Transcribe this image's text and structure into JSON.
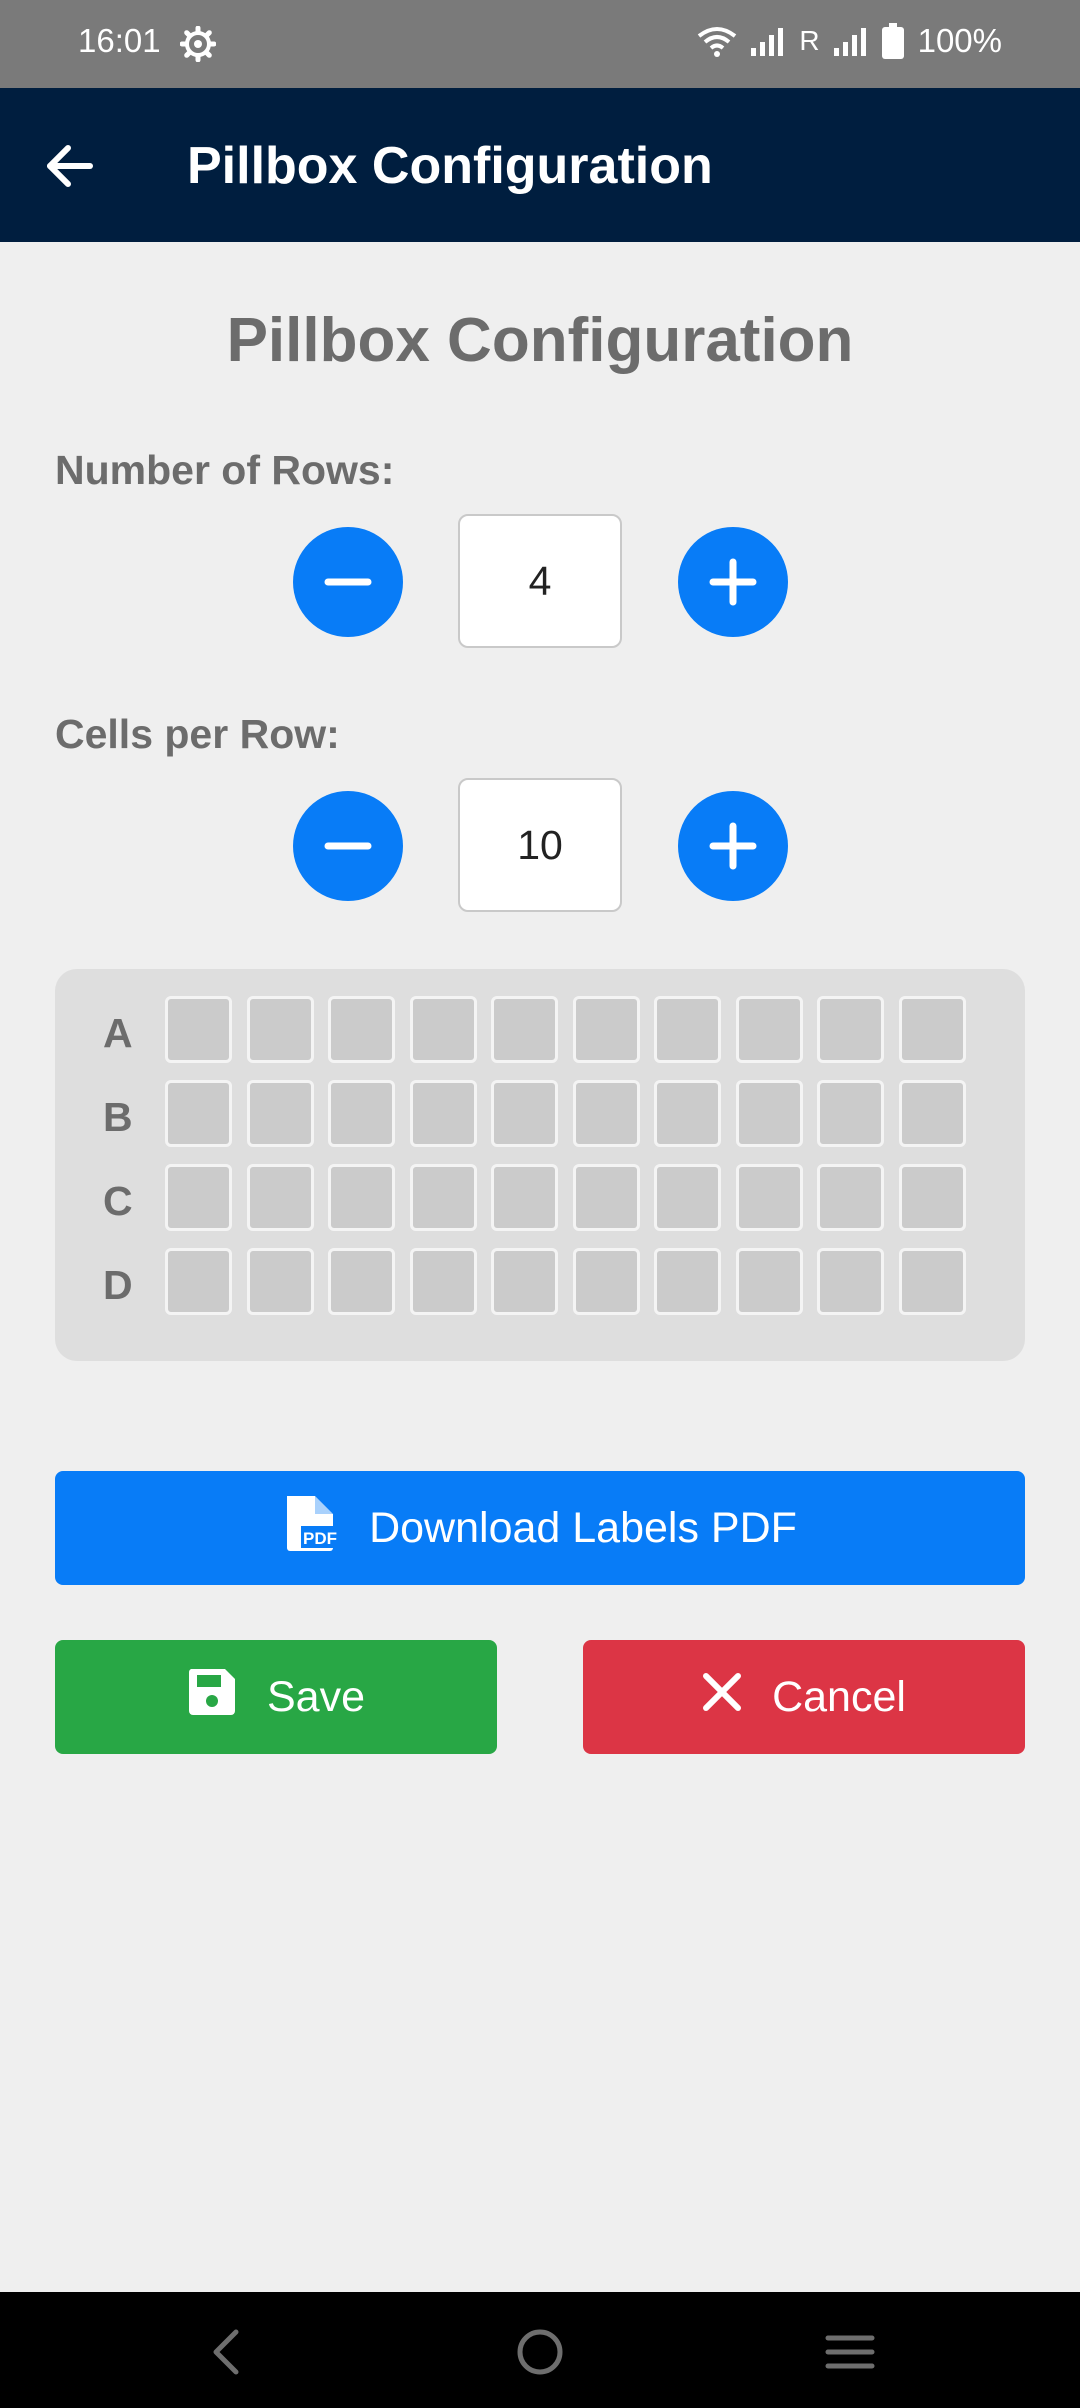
{
  "status_bar": {
    "time": "16:01",
    "roaming": "R",
    "battery": "100%",
    "icons": [
      "settings-icon",
      "wifi-icon",
      "signal-icon",
      "signal-icon",
      "battery-icon"
    ]
  },
  "app_bar": {
    "title": "Pillbox Configuration",
    "back_icon": "arrow-left-icon"
  },
  "main": {
    "title": "Pillbox Configuration",
    "rows": {
      "label": "Number of Rows:",
      "value": "4",
      "decrement_icon": "minus-icon",
      "increment_icon": "plus-icon"
    },
    "cells": {
      "label": "Cells per Row:",
      "value": "10",
      "decrement_icon": "minus-icon",
      "increment_icon": "plus-icon"
    },
    "grid": {
      "row_labels": [
        "A",
        "B",
        "C",
        "D"
      ],
      "cells_per_row": 10
    },
    "buttons": {
      "download": "Download Labels PDF",
      "save": "Save",
      "cancel": "Cancel"
    }
  },
  "colors": {
    "app_bar": "#001e3f",
    "primary": "#087cf7",
    "success": "#28a745",
    "danger": "#dc3545",
    "background": "#efefef"
  },
  "nav_bar": {
    "icons": [
      "back-icon",
      "home-icon",
      "menu-icon"
    ]
  }
}
